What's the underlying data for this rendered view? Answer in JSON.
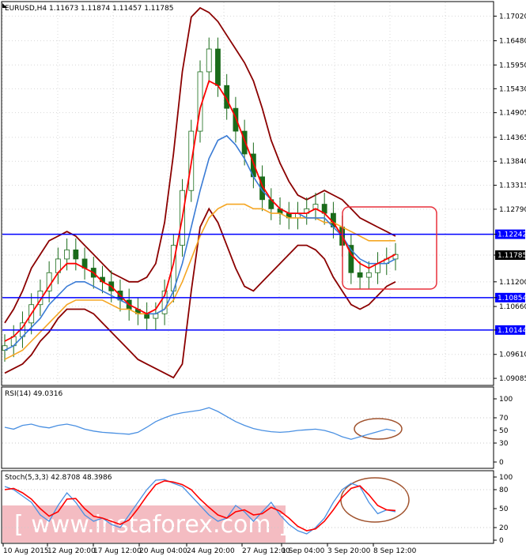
{
  "chart_data": {
    "type": "line",
    "header": "EURUSD,H4  1.11673 1.11874 1.11457 1.11785",
    "price_panel": {
      "ylim": [
        1.09,
        1.172
      ],
      "y_ticks": [
        "1.17020",
        "1.16480",
        "1.15950",
        "1.15430",
        "1.14905",
        "1.14365",
        "1.13840",
        "1.13315",
        "1.12790",
        "1.12242",
        "1.11785",
        "1.11200",
        "1.10854",
        "1.10660",
        "1.10144",
        "1.09610",
        "1.09085"
      ],
      "y_tick_values": [
        1.1702,
        1.1648,
        1.1595,
        1.1543,
        1.14905,
        1.14365,
        1.1384,
        1.13315,
        1.1279,
        1.12242,
        1.11785,
        1.112,
        1.10854,
        1.1066,
        1.10144,
        1.0961,
        1.09085
      ],
      "levels": [
        {
          "label": "1.12242",
          "value": 1.12242,
          "color": "#0000ff"
        },
        {
          "label": "1.10854",
          "value": 1.10854,
          "color": "#0000ff"
        },
        {
          "label": "1.10144",
          "value": 1.10144,
          "color": "#0000ff"
        }
      ],
      "current_price": {
        "label": "1.11785",
        "value": 1.11785
      },
      "closes": [
        1.098,
        1.1,
        1.103,
        1.107,
        1.11,
        1.114,
        1.117,
        1.119,
        1.117,
        1.115,
        1.113,
        1.112,
        1.11,
        1.108,
        1.106,
        1.105,
        1.104,
        1.105,
        1.11,
        1.12,
        1.132,
        1.145,
        1.158,
        1.163,
        1.155,
        1.15,
        1.145,
        1.14,
        1.135,
        1.13,
        1.128,
        1.127,
        1.126,
        1.127,
        1.128,
        1.129,
        1.127,
        1.124,
        1.12,
        1.114,
        1.113,
        1.114,
        1.116,
        1.117,
        1.118
      ],
      "ma_fast": [
        1.099,
        1.1,
        1.102,
        1.105,
        1.108,
        1.111,
        1.114,
        1.116,
        1.116,
        1.115,
        1.114,
        1.112,
        1.111,
        1.109,
        1.107,
        1.106,
        1.105,
        1.106,
        1.109,
        1.116,
        1.126,
        1.138,
        1.15,
        1.156,
        1.155,
        1.152,
        1.148,
        1.143,
        1.138,
        1.133,
        1.13,
        1.128,
        1.127,
        1.127,
        1.127,
        1.128,
        1.127,
        1.125,
        1.122,
        1.118,
        1.116,
        1.115,
        1.116,
        1.117,
        1.118
      ],
      "ma_mid": [
        1.097,
        1.098,
        1.1,
        1.102,
        1.104,
        1.107,
        1.109,
        1.111,
        1.112,
        1.112,
        1.111,
        1.11,
        1.109,
        1.108,
        1.107,
        1.106,
        1.105,
        1.105,
        1.106,
        1.11,
        1.116,
        1.124,
        1.132,
        1.139,
        1.143,
        1.144,
        1.142,
        1.139,
        1.135,
        1.132,
        1.13,
        1.128,
        1.127,
        1.127,
        1.126,
        1.126,
        1.126,
        1.124,
        1.122,
        1.119,
        1.117,
        1.116,
        1.116,
        1.116,
        1.117
      ],
      "ma_slow": [
        1.095,
        1.096,
        1.097,
        1.099,
        1.101,
        1.103,
        1.105,
        1.107,
        1.108,
        1.108,
        1.108,
        1.108,
        1.107,
        1.106,
        1.106,
        1.105,
        1.105,
        1.105,
        1.106,
        1.108,
        1.112,
        1.117,
        1.122,
        1.126,
        1.128,
        1.129,
        1.129,
        1.129,
        1.128,
        1.128,
        1.127,
        1.127,
        1.126,
        1.126,
        1.126,
        1.126,
        1.125,
        1.125,
        1.124,
        1.123,
        1.122,
        1.121,
        1.121,
        1.121,
        1.121
      ],
      "bb_upper": [
        1.103,
        1.106,
        1.11,
        1.115,
        1.118,
        1.121,
        1.122,
        1.123,
        1.122,
        1.12,
        1.118,
        1.116,
        1.114,
        1.113,
        1.112,
        1.112,
        1.113,
        1.116,
        1.125,
        1.14,
        1.158,
        1.17,
        1.172,
        1.171,
        1.169,
        1.166,
        1.163,
        1.16,
        1.156,
        1.15,
        1.143,
        1.138,
        1.134,
        1.131,
        1.13,
        1.131,
        1.132,
        1.131,
        1.13,
        1.128,
        1.126,
        1.125,
        1.124,
        1.123,
        1.122
      ],
      "bb_lower": [
        1.092,
        1.093,
        1.094,
        1.096,
        1.099,
        1.101,
        1.104,
        1.106,
        1.106,
        1.106,
        1.105,
        1.103,
        1.101,
        1.099,
        1.097,
        1.095,
        1.094,
        1.093,
        1.092,
        1.091,
        1.094,
        1.11,
        1.124,
        1.128,
        1.125,
        1.12,
        1.115,
        1.111,
        1.11,
        1.112,
        1.114,
        1.116,
        1.118,
        1.12,
        1.12,
        1.119,
        1.117,
        1.113,
        1.11,
        1.107,
        1.106,
        1.107,
        1.109,
        1.111,
        1.112
      ]
    },
    "rsi_panel": {
      "label": "RSI(14) 49.0316",
      "y_ticks": [
        "100",
        "70",
        "50",
        "30",
        "0"
      ],
      "y_tick_values": [
        100,
        70,
        50,
        30,
        0
      ],
      "values": [
        55,
        52,
        58,
        60,
        56,
        54,
        58,
        60,
        57,
        52,
        49,
        47,
        46,
        45,
        44,
        47,
        55,
        64,
        70,
        75,
        78,
        80,
        82,
        86,
        80,
        72,
        64,
        58,
        53,
        50,
        48,
        47,
        48,
        50,
        51,
        52,
        50,
        46,
        40,
        36,
        40,
        44,
        48,
        52,
        49
      ]
    },
    "stoch_panel": {
      "label": "Stoch(5,3,3) 42.8708 48.3986",
      "y_ticks": [
        "100",
        "80",
        "50",
        "20",
        "0"
      ],
      "y_tick_values": [
        100,
        80,
        50,
        20,
        0
      ],
      "k_values": [
        85,
        80,
        70,
        60,
        40,
        30,
        55,
        75,
        60,
        40,
        30,
        35,
        25,
        20,
        40,
        60,
        80,
        95,
        96,
        90,
        85,
        70,
        55,
        40,
        30,
        35,
        55,
        45,
        30,
        45,
        60,
        40,
        25,
        15,
        10,
        20,
        35,
        60,
        80,
        90,
        85,
        60,
        42,
        48,
        45
      ],
      "d_values": [
        80,
        82,
        75,
        65,
        50,
        38,
        45,
        65,
        66,
        50,
        38,
        35,
        30,
        25,
        32,
        50,
        70,
        88,
        94,
        92,
        88,
        80,
        65,
        52,
        40,
        35,
        45,
        48,
        40,
        42,
        52,
        46,
        35,
        22,
        15,
        18,
        30,
        48,
        68,
        82,
        86,
        72,
        55,
        48,
        47
      ]
    },
    "x_ticks": [
      "10 Aug 2015",
      "12 Aug 20:00",
      "17 Aug 12:00",
      "20 Aug 04:00",
      "24 Aug 20:00",
      "27 Aug 12:00",
      "1 Sep 04:00",
      "3 Sep 20:00",
      "8 Sep 12:00"
    ],
    "watermark": "[   www.instaforex.com   ]",
    "colors": {
      "price_up": "#ff0000",
      "price_down": "#ff0000",
      "ma_fast": "#ff0000",
      "ma_mid": "#3a7bd5",
      "ma_slow": "#f5a623",
      "bollinger": "#8b0000",
      "levels": "#0000ff",
      "rsi": "#4a90e2",
      "stoch_k": "#4a90e2",
      "stoch_d": "#ff0000",
      "highlight_box": "#e8303b",
      "ellipse": "#a0522d",
      "watermark_bg": "#f0a0a8"
    }
  }
}
